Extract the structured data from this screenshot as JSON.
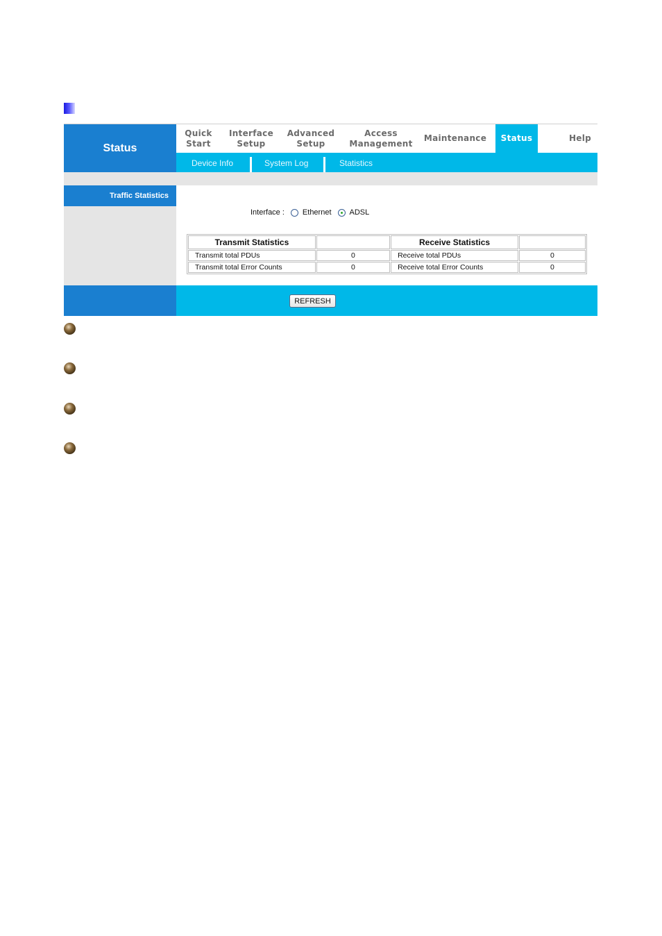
{
  "page": {
    "section_marker": "square-bullet"
  },
  "header": {
    "title": "Status",
    "nav": [
      {
        "line1": "Quick",
        "line2": "Start",
        "active": false
      },
      {
        "line1": "Interface",
        "line2": "Setup",
        "active": false
      },
      {
        "line1": "Advanced",
        "line2": "Setup",
        "active": false
      },
      {
        "line1": "Access",
        "line2": "Management",
        "active": false
      },
      {
        "line1": "Maintenance",
        "line2": "",
        "active": true
      },
      {
        "line1": "Status",
        "line2": "",
        "active": true
      },
      {
        "line1": "Help",
        "line2": "",
        "active": false
      }
    ],
    "subnav": [
      "Device Info",
      "System Log",
      "Statistics"
    ]
  },
  "sidebar": {
    "section_label": "Traffic Statistics"
  },
  "interface": {
    "label": "Interface :",
    "options": [
      "Ethernet",
      "ADSL"
    ],
    "selected": "ADSL"
  },
  "stats_table": {
    "transmit_header": "Transmit Statistics",
    "receive_header": "Receive Statistics",
    "rows": [
      {
        "tx_label": "Transmit total PDUs",
        "tx_value": "0",
        "rx_label": "Receive total PDUs",
        "rx_value": "0"
      },
      {
        "tx_label": "Transmit total Error Counts",
        "tx_value": "0",
        "rx_label": "Receive total Error Counts",
        "rx_value": "0"
      }
    ]
  },
  "footer": {
    "refresh_label": "REFRESH"
  },
  "bullets": {
    "count": 4,
    "icon": "sphere-bullet-icon"
  },
  "colors": {
    "brand_blue": "#1a7fd0",
    "cyan": "#00b8e8",
    "panel_gray": "#e5e5e5",
    "nav_text": "#6b6b6b"
  }
}
